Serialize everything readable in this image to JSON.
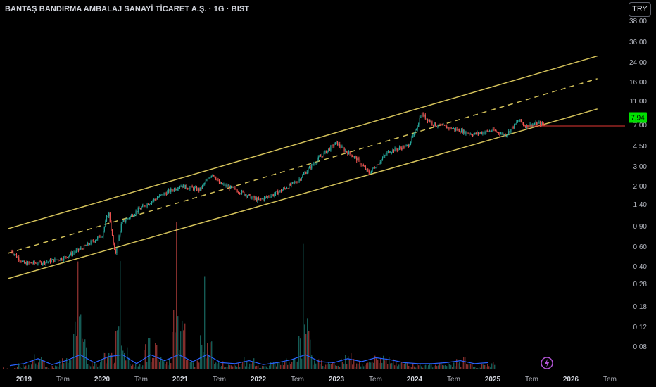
{
  "header": {
    "title": "BANTAŞ BANDIRMA AMBALAJ SANAYİ TİCARET A.Ş. · 1G · BIST",
    "currency": "TRY"
  },
  "colors": {
    "background": "#000000",
    "channel": "#d4c25a",
    "up": "#26a69a",
    "down": "#ef5350",
    "volume_line": "#2962ff",
    "last_price_bg": "#00e000",
    "support_line": "#26a69a",
    "resistance_line": "#e53935",
    "alert_icon": "#b455d8"
  },
  "chart_data": {
    "type": "line",
    "title": "BANTAŞ BANDIRMA AMBALAJ SANAYİ TİCARET A.Ş. · 1G · BIST",
    "scale": "log",
    "y_ticks": [
      "38,00",
      "36,00",
      "24,00",
      "16,00",
      "11,00",
      "7,00",
      "4,50",
      "3,00",
      "2,00",
      "1,40",
      "0,90",
      "0,60",
      "0,40",
      "0,28",
      "0,18",
      "0,12",
      "0,08"
    ],
    "x_ticks": [
      "2019",
      "Tem",
      "2020",
      "Tem",
      "2021",
      "Tem",
      "2022",
      "Tem",
      "2023",
      "Tem",
      "2024",
      "Tem",
      "2025",
      "Tem",
      "2026",
      "Tem"
    ],
    "last_price": "7,94",
    "series": [
      {
        "x": [
          "2018-11",
          "2019-01",
          "2019-04",
          "2019-07",
          "2019-10",
          "2020-01",
          "2020-02",
          "2020-03",
          "2020-04",
          "2020-07",
          "2020-10",
          "2021-01",
          "2021-04",
          "2021-06",
          "2021-07",
          "2021-10",
          "2022-01",
          "2022-04",
          "2022-07",
          "2022-10",
          "2023-01",
          "2023-02",
          "2023-04",
          "2023-06",
          "2023-09",
          "2023-12",
          "2024-01",
          "2024-02",
          "2024-04",
          "2024-07",
          "2024-10",
          "2025-01",
          "2025-03",
          "2025-05",
          "2025-06",
          "2025-08",
          "2025-09"
        ],
        "values": [
          0.55,
          0.42,
          0.43,
          0.47,
          0.58,
          0.75,
          1.2,
          0.5,
          0.95,
          1.3,
          1.65,
          2.0,
          1.85,
          2.6,
          2.1,
          1.8,
          1.5,
          1.75,
          2.2,
          3.4,
          4.8,
          4.2,
          3.5,
          2.6,
          4.0,
          4.5,
          5.8,
          8.6,
          7.0,
          6.4,
          5.7,
          6.2,
          5.6,
          7.6,
          6.8,
          7.1,
          7.0
        ]
      }
    ],
    "volume": [
      1,
      3,
      8,
      2,
      6,
      40,
      4,
      10,
      22,
      3,
      16,
      6,
      30,
      5,
      18,
      4,
      3,
      6,
      2,
      4,
      7,
      26,
      5,
      4,
      8,
      5,
      9,
      7,
      4,
      3,
      3,
      4,
      6,
      3,
      4,
      3
    ],
    "channel": {
      "start": "2018-11",
      "end": "2026-04",
      "upper": [
        0.85,
        27
      ],
      "middle": [
        0.52,
        17
      ],
      "lower": [
        0.31,
        9.4
      ]
    },
    "levels": [
      {
        "name": "resistance",
        "value": 7.94,
        "from": "2025-06"
      },
      {
        "name": "support",
        "value": 6.8,
        "from": "2025-06"
      }
    ]
  }
}
